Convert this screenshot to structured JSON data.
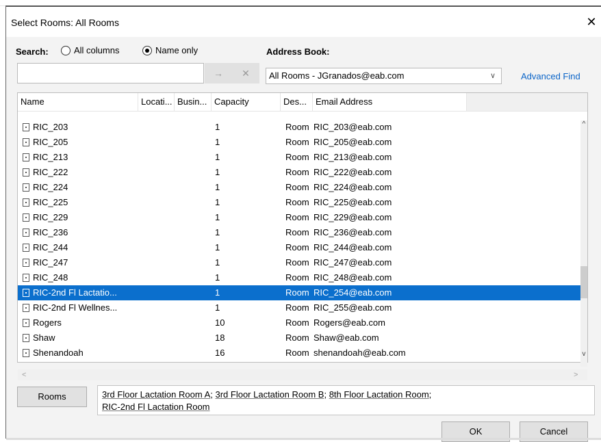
{
  "window": {
    "title": "Select Rooms: All Rooms",
    "close_glyph": "✕"
  },
  "search": {
    "label": "Search:",
    "options": [
      {
        "label": "All columns",
        "selected": false
      },
      {
        "label": "Name only",
        "selected": true
      }
    ],
    "value": "",
    "go_glyph": "→",
    "clear_glyph": "✕"
  },
  "address_book": {
    "label": "Address Book:",
    "selected": "All Rooms - JGranados@eab.com",
    "chevron_glyph": "∨",
    "advanced_find": "Advanced Find"
  },
  "table": {
    "columns": [
      "Name",
      "Locati...",
      "Busin...",
      "Capacity",
      "Des...",
      "Email Address"
    ],
    "rows": [
      {
        "name": "RIC_203",
        "capacity": "1",
        "description": "Room",
        "email": "RIC_203@eab.com",
        "selected": false
      },
      {
        "name": "RIC_205",
        "capacity": "1",
        "description": "Room",
        "email": "RIC_205@eab.com",
        "selected": false
      },
      {
        "name": "RIC_213",
        "capacity": "1",
        "description": "Room",
        "email": "RIC_213@eab.com",
        "selected": false
      },
      {
        "name": "RIC_222",
        "capacity": "1",
        "description": "Room",
        "email": "RIC_222@eab.com",
        "selected": false
      },
      {
        "name": "RIC_224",
        "capacity": "1",
        "description": "Room",
        "email": "RIC_224@eab.com",
        "selected": false
      },
      {
        "name": "RIC_225",
        "capacity": "1",
        "description": "Room",
        "email": "RIC_225@eab.com",
        "selected": false
      },
      {
        "name": "RIC_229",
        "capacity": "1",
        "description": "Room",
        "email": "RIC_229@eab.com",
        "selected": false
      },
      {
        "name": "RIC_236",
        "capacity": "1",
        "description": "Room",
        "email": "RIC_236@eab.com",
        "selected": false
      },
      {
        "name": "RIC_244",
        "capacity": "1",
        "description": "Room",
        "email": "RIC_244@eab.com",
        "selected": false
      },
      {
        "name": "RIC_247",
        "capacity": "1",
        "description": "Room",
        "email": "RIC_247@eab.com",
        "selected": false
      },
      {
        "name": "RIC_248",
        "capacity": "1",
        "description": "Room",
        "email": "RIC_248@eab.com",
        "selected": false
      },
      {
        "name": "RIC-2nd Fl Lactatio...",
        "capacity": "1",
        "description": "Room",
        "email": "RIC_254@eab.com",
        "selected": true
      },
      {
        "name": "RIC-2nd Fl Wellnes...",
        "capacity": "1",
        "description": "Room",
        "email": "RIC_255@eab.com",
        "selected": false
      },
      {
        "name": "Rogers",
        "capacity": "10",
        "description": "Room",
        "email": "Rogers@eab.com",
        "selected": false
      },
      {
        "name": "Shaw",
        "capacity": "18",
        "description": "Room",
        "email": "Shaw@eab.com",
        "selected": false
      },
      {
        "name": "Shenandoah",
        "capacity": "16",
        "description": "Room",
        "email": "shenandoah@eab.com",
        "selected": false
      }
    ]
  },
  "scroll": {
    "up_glyph": "^",
    "down_glyph": "v",
    "left_glyph": "<",
    "right_glyph": ">"
  },
  "rooms": {
    "button_label": "Rooms",
    "selected": [
      "3rd Floor Lactation Room A",
      "3rd Floor Lactation Room B",
      "8th Floor Lactation Room",
      "RIC-2nd Fl Lactation Room"
    ]
  },
  "buttons": {
    "ok": "OK",
    "cancel": "Cancel"
  },
  "colors": {
    "selection": "#0b6fcd",
    "link": "#0a64c8"
  }
}
